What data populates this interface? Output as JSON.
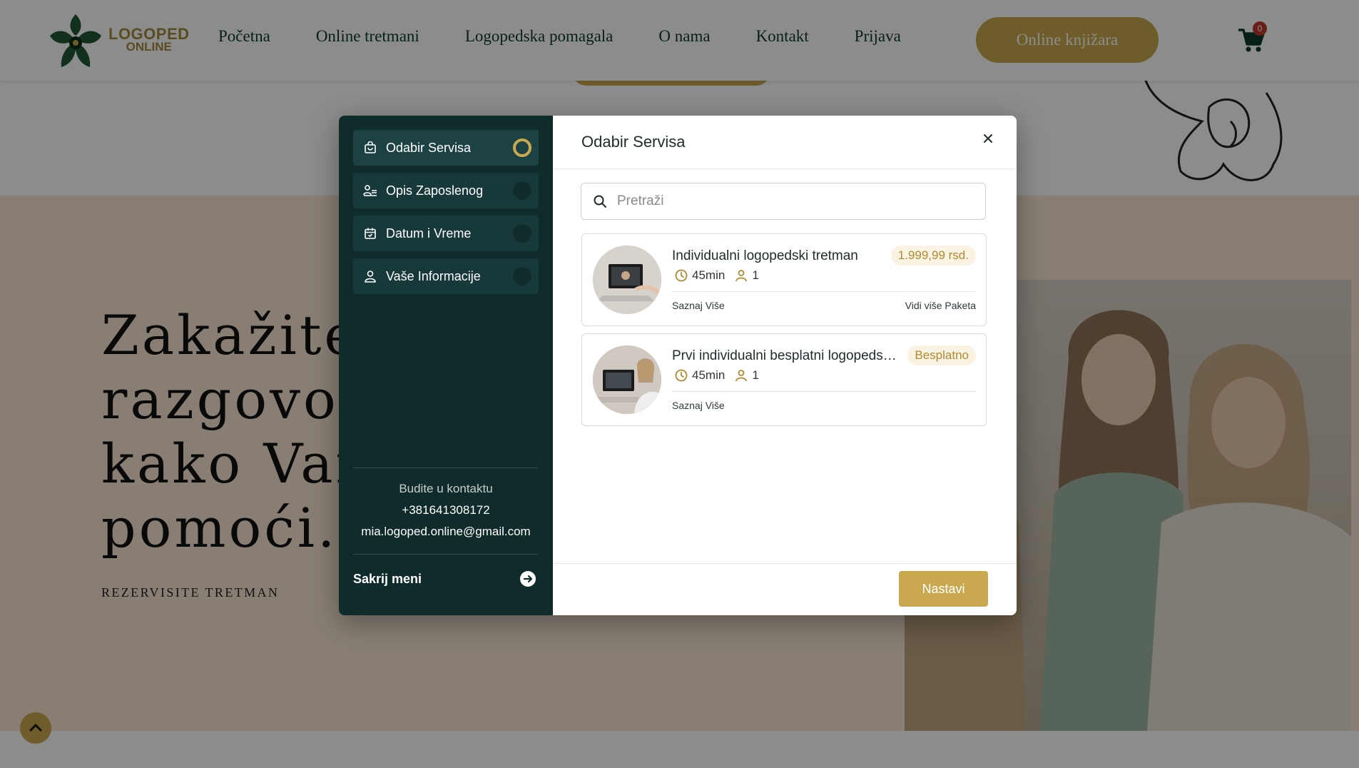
{
  "header": {
    "logo": {
      "line1": "LOGOPED",
      "line2": "ONLINE"
    },
    "nav": [
      "Početna",
      "Online tretmani",
      "Logopedska pomagala",
      "O nama",
      "Kontakt",
      "Prijava"
    ],
    "shop_button": "Online knjižara",
    "cart_count": "0"
  },
  "hero": {
    "title": "Zakažite\nrazgovor\nkako Van\npomoći.",
    "subtitle": "REZERVISITE TRETMAN"
  },
  "modal": {
    "steps": [
      {
        "label": "Odabir Servisa",
        "icon": "bag-icon",
        "active": true
      },
      {
        "label": "Opis Zaposlenog",
        "icon": "employee-icon",
        "active": false
      },
      {
        "label": "Datum i Vreme",
        "icon": "calendar-icon",
        "active": false
      },
      {
        "label": "Vaše Informacije",
        "icon": "user-icon",
        "active": false
      }
    ],
    "contact": {
      "heading": "Budite u kontaktu",
      "phone": "+381641308172",
      "email": "mia.logoped.online@gmail.com"
    },
    "hide_menu": "Sakrij meni",
    "title": "Odabir Servisa",
    "search": {
      "placeholder": "Pretraži"
    },
    "services": [
      {
        "name": "Individualni logopedski tretman",
        "price": "1.999,99 rsd.",
        "duration": "45min",
        "capacity": "1",
        "more": "Saznaj Više",
        "packages": "Vidi više Paketa"
      },
      {
        "name": "Prvi individualni besplatni logopedski tretman",
        "price": "Besplatno",
        "duration": "45min",
        "capacity": "1",
        "more": "Saznaj Više"
      }
    ],
    "continue_button": "Nastavi"
  },
  "colors": {
    "accent": "#c9a84f",
    "sidebar": "#0f2c2b",
    "nav_text": "#0b3b2a"
  }
}
